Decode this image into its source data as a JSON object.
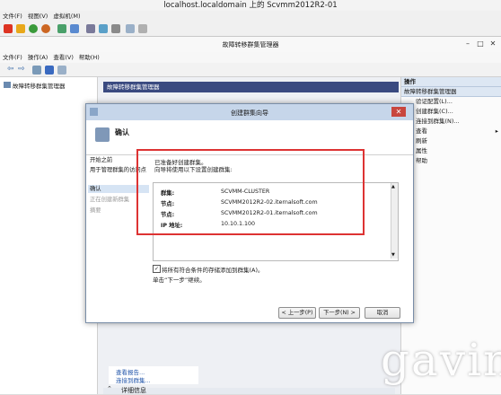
{
  "vm": {
    "title": "localhost.localdomain 上的 Scvmm2012R2-01",
    "menu": [
      "文件(F)",
      "视图(V)",
      "虚拟机(M)"
    ]
  },
  "fcm": {
    "title": "故障转移群集管理器",
    "menu": [
      "文件(F)",
      "操作(A)",
      "查看(V)",
      "帮助(H)"
    ],
    "tree_root": "故障转移群集管理器",
    "center_header": "故障转移群集管理器",
    "center_links": [
      "查看报告...",
      "连接到群集..."
    ],
    "details_label": "详细信息",
    "actions": {
      "header": "操作",
      "subheader": "故障转移群集管理器",
      "items": [
        "验证配置(L)...",
        "创建群集(C)...",
        "连接到群集(N)...",
        "查看",
        "刷新",
        "属性",
        "帮助"
      ]
    }
  },
  "wizard": {
    "title": "创建群集向导",
    "heading": "确认",
    "nav": [
      "开始之前",
      "用于管理群集的访问点",
      "确认",
      "正在创建新群集",
      "摘要"
    ],
    "intro_line1": "已准备好创建群集。",
    "intro_line2": "向导将使用以下设置创建群集:",
    "summary": [
      {
        "label": "群集:",
        "value": "SCVMM-CLUSTER"
      },
      {
        "label": "节点:",
        "value": "SCVMM2012R2-02.iternalsoft.com"
      },
      {
        "label": "节点:",
        "value": "SCVMM2012R2-01.iternalsoft.com"
      },
      {
        "label": "IP 地址:",
        "value": "10.10.1.100"
      }
    ],
    "checkbox_label": "将所有符合条件的存储添加到群集(A)。",
    "checkbox_checked": true,
    "next_hint": "单击“下一步”继续。",
    "buttons": {
      "prev": "< 上一步(P)",
      "next": "下一步(N) >",
      "cancel": "取消"
    }
  },
  "watermark": "gavin"
}
